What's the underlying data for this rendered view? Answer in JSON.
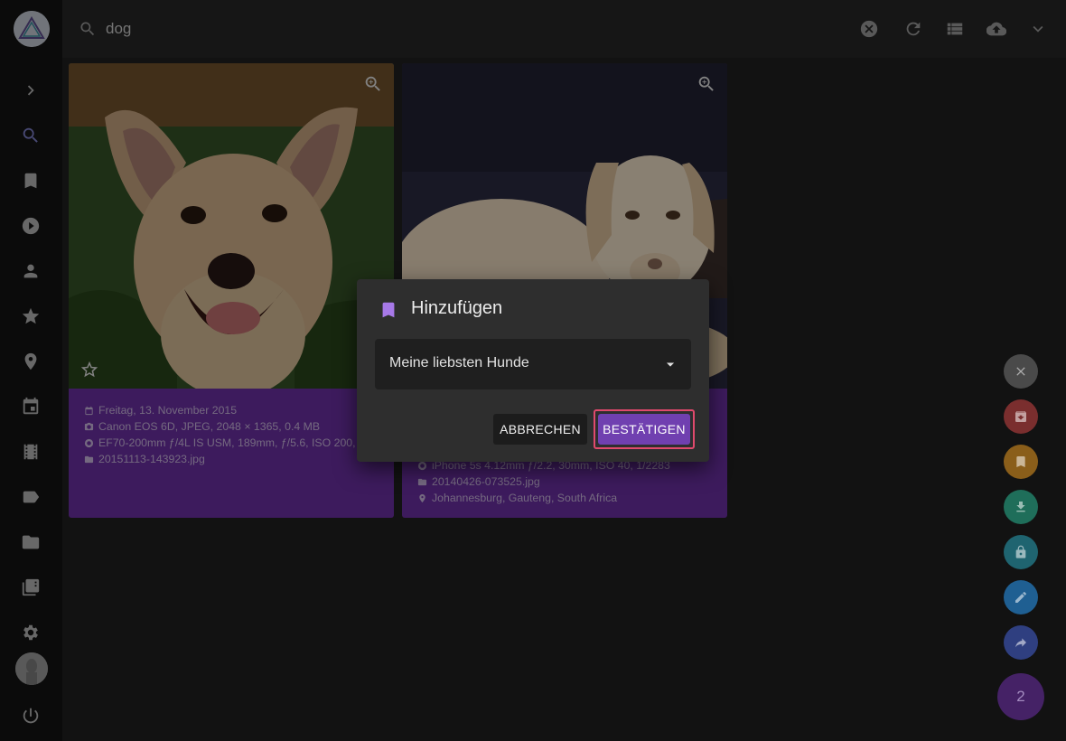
{
  "search": {
    "value": "dog"
  },
  "cards": [
    {
      "date": "Freitag, 13. November 2015",
      "camera": "Canon EOS 6D, JPEG, 2048 × 1365, 0.4 MB",
      "lens": "EF70-200mm ƒ/4L IS USM, 189mm, ƒ/5.6, ISO 200,",
      "file": "20151113-143923.jpg"
    },
    {
      "lens": "iPhone 5s 4.12mm ƒ/2.2, 30mm, ISO 40, 1/2283",
      "file": "20140426-073525.jpg",
      "location": "Johannesburg, Gauteng, South Africa"
    }
  ],
  "dialog": {
    "title": "Hinzufügen",
    "selected_album": "Meine liebsten Hunde",
    "cancel_label": "ABBRECHEN",
    "confirm_label": "BESTÄTIGEN"
  },
  "fab": {
    "selection_count": "2"
  },
  "colors": {
    "accent": "#7040b0",
    "card": "#6a2fa1",
    "highlight": "#e04a6d",
    "fab_close": "#4a4a4a",
    "fab_archive": "#7a2e2e",
    "fab_album": "#8a5e1a",
    "fab_download": "#1f6e5a",
    "fab_private": "#1f6470",
    "fab_edit": "#1f5f92",
    "fab_share": "#2f3f80"
  }
}
